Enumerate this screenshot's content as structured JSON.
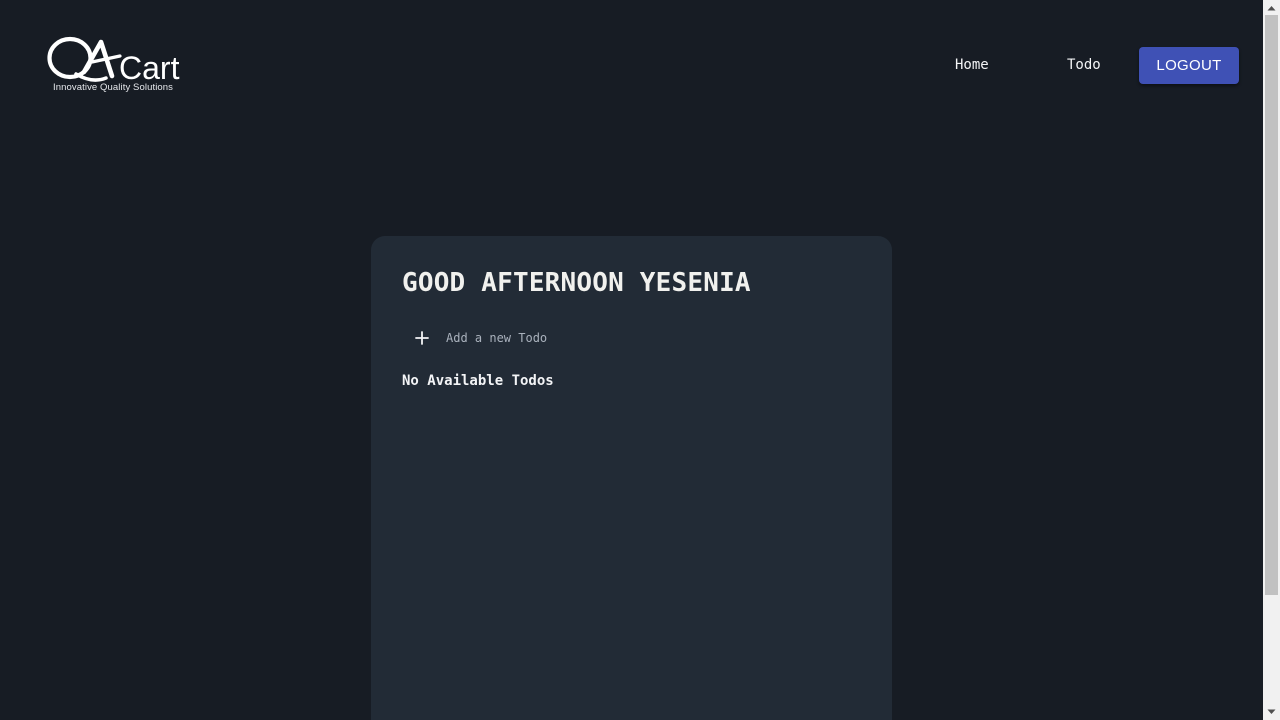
{
  "brand": {
    "name": "QACart",
    "tagline": "Innovative Quality Solutions"
  },
  "nav": {
    "home_label": "Home",
    "todo_label": "Todo",
    "logout_label": "LOGOUT"
  },
  "card": {
    "greeting": "GOOD AFTERNOON YESENIA",
    "add_todo_placeholder": "Add a new Todo",
    "add_todo_value": "",
    "empty_message": "No Available Todos"
  },
  "icons": {
    "add": "plus-icon",
    "scroll_up": "chevron-up-icon",
    "scroll_down": "chevron-down-icon"
  },
  "colors": {
    "background": "#171c24",
    "card": "#222b36",
    "accent": "#3f51b5",
    "text": "#f1f1ee",
    "placeholder": "#a9b1bc"
  }
}
